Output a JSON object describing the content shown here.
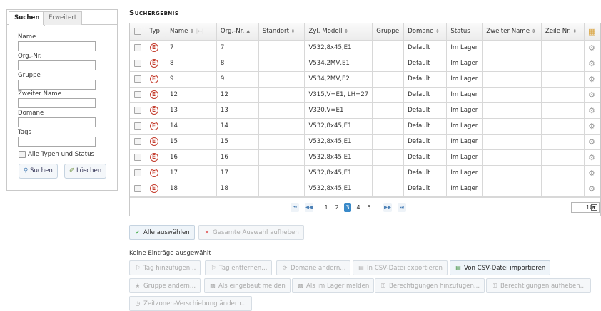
{
  "search_panel": {
    "tabs": [
      "Suchen",
      "Erweitert"
    ],
    "fields": {
      "name": {
        "label": "Name",
        "value": ""
      },
      "org_nr": {
        "label": "Org.-Nr.",
        "value": ""
      },
      "gruppe": {
        "label": "Gruppe",
        "value": ""
      },
      "zweiter_name": {
        "label": "Zweiter Name",
        "value": ""
      },
      "domaene": {
        "label": "Domäne",
        "value": ""
      },
      "tags": {
        "label": "Tags",
        "value": ""
      }
    },
    "all_types_checkbox": "Alle Typen und Status",
    "search_button": "Suchen",
    "clear_button": "Löschen"
  },
  "results": {
    "title": "Suchergebnis",
    "columns": [
      "",
      "Typ",
      "Name",
      "Org.-Nr.",
      "Standort",
      "Zyl. Modell",
      "Gruppe",
      "Domäne",
      "Status",
      "Zweiter Name",
      "Zeile Nr."
    ],
    "rows": [
      {
        "typ": "E",
        "name": "7",
        "org": "7",
        "standort": "",
        "modell": "V532,8x45,E1",
        "gruppe": "",
        "domaene": "Default",
        "status": "Im Lager",
        "zweiter": "",
        "zeile": ""
      },
      {
        "typ": "E",
        "name": "8",
        "org": "8",
        "standort": "",
        "modell": "V534,2MV,E1",
        "gruppe": "",
        "domaene": "Default",
        "status": "Im Lager",
        "zweiter": "",
        "zeile": ""
      },
      {
        "typ": "E",
        "name": "9",
        "org": "9",
        "standort": "",
        "modell": "V534,2MV,E2",
        "gruppe": "",
        "domaene": "Default",
        "status": "Im Lager",
        "zweiter": "",
        "zeile": ""
      },
      {
        "typ": "E",
        "name": "12",
        "org": "12",
        "standort": "",
        "modell": "V315,V=E1, LH=27",
        "gruppe": "",
        "domaene": "Default",
        "status": "Im Lager",
        "zweiter": "",
        "zeile": ""
      },
      {
        "typ": "E",
        "name": "13",
        "org": "13",
        "standort": "",
        "modell": "V320,V=E1",
        "gruppe": "",
        "domaene": "Default",
        "status": "Im Lager",
        "zweiter": "",
        "zeile": ""
      },
      {
        "typ": "E",
        "name": "14",
        "org": "14",
        "standort": "",
        "modell": "V532,8x45,E1",
        "gruppe": "",
        "domaene": "Default",
        "status": "Im Lager",
        "zweiter": "",
        "zeile": ""
      },
      {
        "typ": "E",
        "name": "15",
        "org": "15",
        "standort": "",
        "modell": "V532,8x45,E1",
        "gruppe": "",
        "domaene": "Default",
        "status": "Im Lager",
        "zweiter": "",
        "zeile": ""
      },
      {
        "typ": "E",
        "name": "16",
        "org": "16",
        "standort": "",
        "modell": "V532,8x45,E1",
        "gruppe": "",
        "domaene": "Default",
        "status": "Im Lager",
        "zweiter": "",
        "zeile": ""
      },
      {
        "typ": "E",
        "name": "17",
        "org": "17",
        "standort": "",
        "modell": "V532,8x45,E1",
        "gruppe": "",
        "domaene": "Default",
        "status": "Im Lager",
        "zweiter": "",
        "zeile": ""
      },
      {
        "typ": "E",
        "name": "18",
        "org": "18",
        "standort": "",
        "modell": "V532,8x45,E1",
        "gruppe": "",
        "domaene": "Default",
        "status": "Im Lager",
        "zweiter": "",
        "zeile": ""
      }
    ],
    "pagination": {
      "first": "⏮",
      "prev": "◀◀",
      "pages": [
        "1",
        "2",
        "3",
        "4",
        "5"
      ],
      "current": "3",
      "next": "▶▶",
      "last": "⏭",
      "page_size": "10"
    }
  },
  "actions": {
    "select_all": "Alle auswählen",
    "clear_selection": "Gesamte Auswahl aufheben",
    "info": "Keine Einträge ausgewählt",
    "add_tag": "Tag hinzufügen...",
    "remove_tag": "Tag entfernen...",
    "change_domain": "Domäne ändern...",
    "export_csv": "In CSV-Datei exportieren",
    "import_csv": "Von CSV-Datei importieren",
    "change_group": "Gruppe ändern...",
    "report_installed": "Als eingebaut melden",
    "report_stock": "Als im Lager melden",
    "add_permissions": "Berechtigungen hinzufügen...",
    "remove_permissions": "Berechtigungen aufheben...",
    "timezone_shift": "Zeitzonen-Verschiebung ändern..."
  },
  "colors": {
    "accent": "#3a8ac9",
    "type_icon": "#c43c2d",
    "select_all_icon": "#4caf50",
    "clear_icon": "#e57373"
  }
}
